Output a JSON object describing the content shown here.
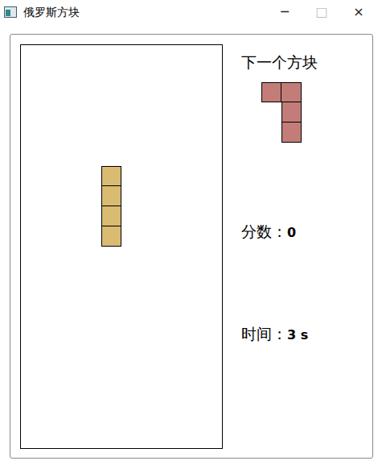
{
  "window": {
    "title": "俄罗斯方块",
    "controls": [
      "─",
      "□",
      "×"
    ]
  },
  "board": {
    "current_piece": {
      "cells": [
        [
          4,
          6
        ],
        [
          4,
          7
        ],
        [
          4,
          8
        ],
        [
          4,
          9
        ]
      ],
      "color": "#d9bc72"
    }
  },
  "next": {
    "label": "下一个方块",
    "piece": {
      "cells": [
        [
          1,
          0
        ],
        [
          2,
          0
        ],
        [
          2,
          1
        ],
        [
          2,
          2
        ]
      ],
      "color": "#c27d78"
    }
  },
  "score": {
    "label": "分数：",
    "value": "0"
  },
  "time": {
    "label": "时间：",
    "value": "3 s"
  }
}
